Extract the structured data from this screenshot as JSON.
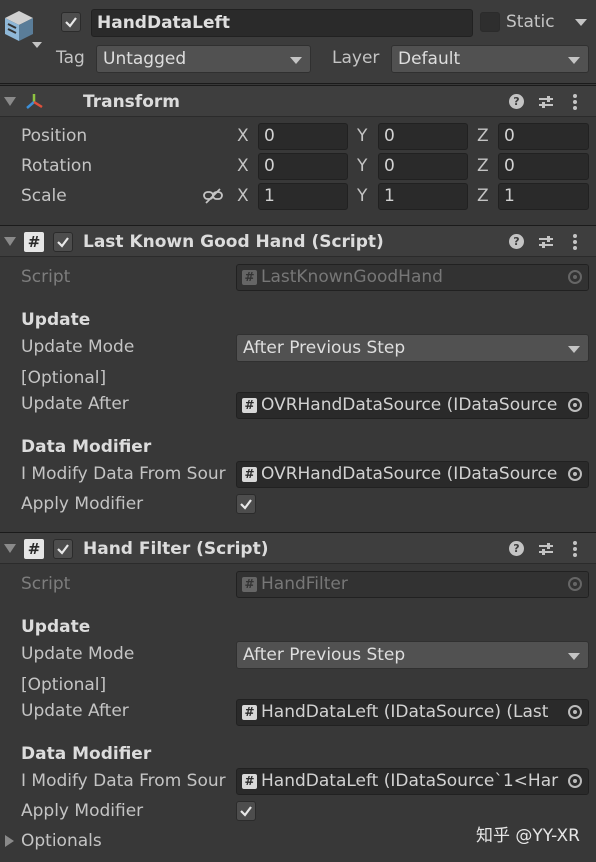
{
  "header": {
    "object_name": "HandDataLeft",
    "static_label": "Static",
    "tag_label": "Tag",
    "tag_value": "Untagged",
    "layer_label": "Layer",
    "layer_value": "Default"
  },
  "transform": {
    "title": "Transform",
    "rows": [
      {
        "label": "Position",
        "x": "0",
        "y": "0",
        "z": "0"
      },
      {
        "label": "Rotation",
        "x": "0",
        "y": "0",
        "z": "0"
      },
      {
        "label": "Scale",
        "x": "1",
        "y": "1",
        "z": "1"
      }
    ],
    "axis": {
      "x": "X",
      "y": "Y",
      "z": "Z"
    }
  },
  "lkgh": {
    "title": "Last Known Good Hand (Script)",
    "script_label": "Script",
    "script_value": "LastKnownGoodHand",
    "update_header": "Update",
    "update_mode_label": "Update Mode",
    "update_mode_value": "After Previous Step",
    "optional_label": "[Optional]",
    "update_after_label": "Update After",
    "update_after_value": "OVRHandDataSource (IDataSource",
    "data_modifier_header": "Data Modifier",
    "modify_label": "I Modify Data From Sour",
    "modify_value": "OVRHandDataSource (IDataSource",
    "apply_label": "Apply Modifier"
  },
  "handfilter": {
    "title": "Hand Filter (Script)",
    "script_label": "Script",
    "script_value": "HandFilter",
    "update_header": "Update",
    "update_mode_label": "Update Mode",
    "update_mode_value": "After Previous Step",
    "optional_label": "[Optional]",
    "update_after_label": "Update After",
    "update_after_value": "HandDataLeft (IDataSource) (Last",
    "data_modifier_header": "Data Modifier",
    "modify_label": "I Modify Data From Sour",
    "modify_value": "HandDataLeft (IDataSource`1<Har",
    "apply_label": "Apply Modifier",
    "optionals_label": "Optionals"
  },
  "watermark": "知乎 @YY-XR",
  "colors": {
    "background": "#383838",
    "field": "#2a2a2a",
    "header": "#3e3e3e"
  }
}
